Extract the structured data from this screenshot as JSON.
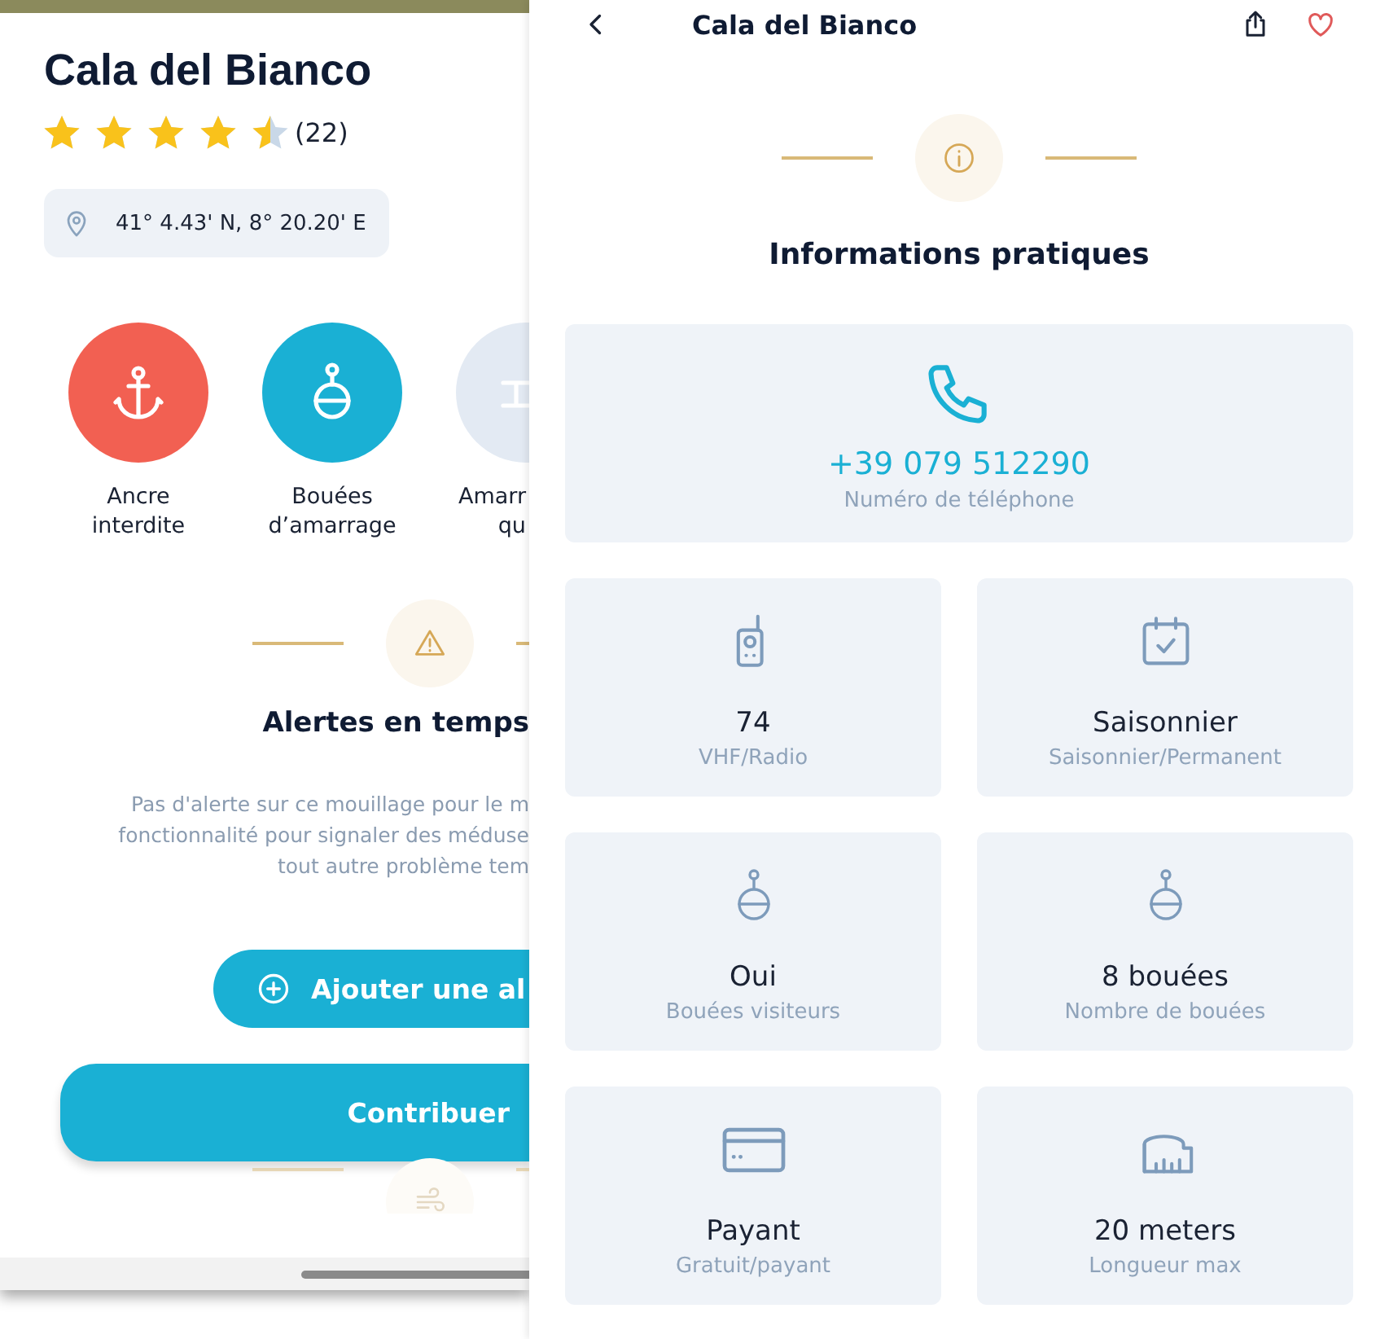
{
  "spot": {
    "title": "Cala del Bianco",
    "stars": 4.5,
    "review_count": "(22)",
    "coordinates": "41° 4.43' N, 8° 20.20' E",
    "amenities": [
      {
        "kind": "anchor",
        "label": "Ancre\ninterdite",
        "color": "#f26052"
      },
      {
        "kind": "buoy",
        "label": "Bouées\nd’amarrage",
        "color": "#1ab0d4"
      },
      {
        "kind": "mooring",
        "label": "Amarr\nqu",
        "color": "#e3eaf3"
      }
    ],
    "alerts": {
      "title": "Alertes en temps",
      "text": "Pas d'alerte sur ce mouillage pour le m\nfonctionnalité pour signaler des méduse\ntout autre problème tem",
      "add_button": "Ajouter une al"
    },
    "contribute_button": "Contribuer"
  },
  "detail": {
    "header_title": "Cala del Bianco",
    "section_title": "Informations pratiques",
    "phone": {
      "value": "+39 079 512290",
      "label": "Numéro de téléphone"
    },
    "cards": [
      {
        "kind": "vhf",
        "value": "74",
        "label": "VHF/Radio"
      },
      {
        "kind": "season",
        "value": "Saisonnier",
        "label": "Saisonnier/Permanent"
      },
      {
        "kind": "visitor_buoys",
        "value": "Oui",
        "label": "Bouées visiteurs"
      },
      {
        "kind": "buoy_count",
        "value": "8 bouées",
        "label": "Nombre de bouées"
      },
      {
        "kind": "payment",
        "value": "Payant",
        "label": "Gratuit/payant"
      },
      {
        "kind": "length",
        "value": "20 meters",
        "label": "Longueur max"
      }
    ]
  }
}
